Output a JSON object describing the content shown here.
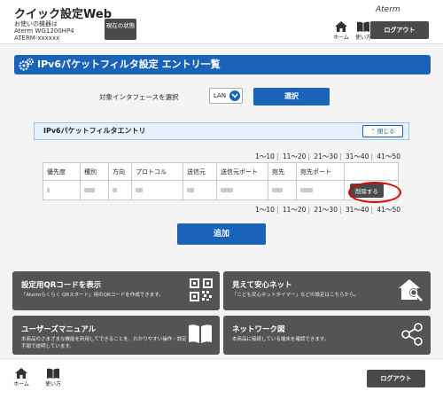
{
  "header": {
    "app_title": "クイック設定Web",
    "device_label": "お使いの機器は",
    "device_model": "Aterm WG1200HP4",
    "device_id": "ATERM-xxxxxx",
    "status_button": "現在の状態",
    "brand": "Aterm",
    "home_label": "ホーム",
    "help_label": "使い方",
    "logout_label": "ログアウト"
  },
  "page_title": "IPv6パケットフィルタ設定 エントリ一覧",
  "interface": {
    "label": "対象インタフェースを選択",
    "selected": "LAN",
    "select_button": "選択"
  },
  "section": {
    "title": "IPv6パケットフィルタエントリ",
    "collapse_label": "閉じる"
  },
  "pager": [
    "1～10",
    "11～20",
    "21～30",
    "31～40",
    "41～50"
  ],
  "table": {
    "columns": [
      "優先度",
      "種別",
      "方向",
      "プロトコル",
      "送信元",
      "送信元ポート",
      "宛先",
      "宛先ポート",
      ""
    ],
    "delete_label": "削除する"
  },
  "add_button": "追加",
  "tiles": {
    "qr": {
      "title": "設定用QRコードを表示",
      "desc": "「Atermらくらく QRスタート」用のQRコードを作成できます。",
      "icon": "qr-code-icon"
    },
    "safe": {
      "title": "見えて安心ネット",
      "desc": "「こども安心ネットタイマー」などの設定はこちらから。",
      "icon": "home-search-icon"
    },
    "manual": {
      "title": "ユーザーズマニュアル",
      "desc": "本商品のさまざまな機能を利用してできることを、わかりやすい操作・設定手順で説明しています。",
      "icon": "book-icon"
    },
    "network": {
      "title": "ネットワーク図",
      "desc": "本商品に接続している端末を確認できます。",
      "icon": "network-icon"
    }
  },
  "footer": {
    "home_label": "ホーム",
    "help_label": "使い方",
    "logout_label": "ログアウト"
  }
}
